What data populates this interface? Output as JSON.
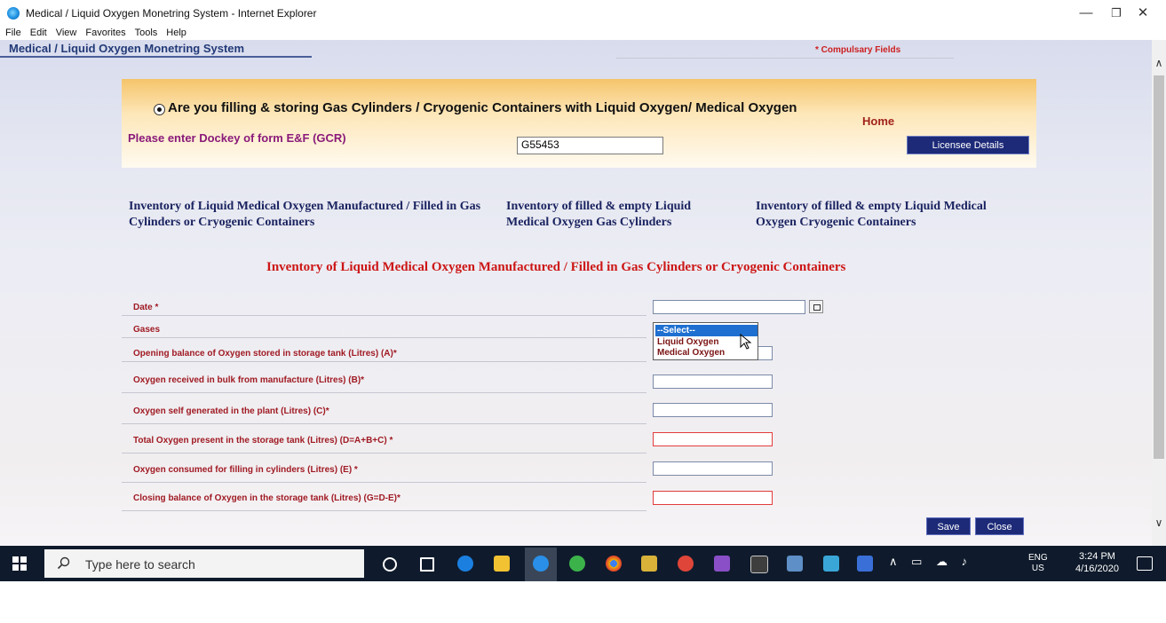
{
  "window": {
    "title": "Medical / Liquid Oxygen Monetring System - Internet Explorer",
    "controls": [
      "—",
      "❐",
      "✕"
    ]
  },
  "menubar": [
    "File",
    "Edit",
    "View",
    "Favorites",
    "Tools",
    "Help"
  ],
  "app": {
    "title": "Medical / Liquid Oxygen Monetring System",
    "required_note": "* Compulsary Fields"
  },
  "banner": {
    "question": "Are you filling & storing Gas Cylinders / Cryogenic Containers with Liquid Oxygen/ Medical Oxygen",
    "home": "Home",
    "dockey_label": "Please enter Dockey of form E&F (GCR)",
    "dockey_value": "G55453",
    "licensee_button": "Licensee Details"
  },
  "inventory_links": [
    "Inventory of Liquid Medical Oxygen Manufactured / Filled in Gas Cylinders or Cryogenic Containers",
    "Inventory of filled & empty Liquid Medical Oxygen Gas Cylinders",
    "Inventory of filled & empty Liquid Medical Oxygen Cryogenic Containers"
  ],
  "section_title": "Inventory of Liquid Medical Oxygen Manufactured / Filled in Gas Cylinders or Cryogenic Containers",
  "form": {
    "date_label": "Date *",
    "gases_label": "Gases",
    "gases_options": [
      "--Select--",
      "Liquid Oxygen",
      "Medical Oxygen"
    ],
    "opening_label": "Opening balance of Oxygen stored in storage tank (Litres) (A)*",
    "received_label": "Oxygen received in bulk from manufacture (Litres) (B)*",
    "self_generated_label": "Oxygen self generated in the plant (Litres) (C)*",
    "total_label": "Total Oxygen present in the storage tank (Litres) (D=A+B+C) *",
    "consumed_label": "Oxygen consumed for filling in cylinders (Litres) (E) *",
    "closing_label": "Closing balance of Oxygen in the storage tank (Litres) (G=D-E)*"
  },
  "buttons": {
    "save": "Save",
    "close": "Close"
  },
  "taskbar": {
    "search_placeholder": "Type here to search",
    "lang_top": "ENG",
    "lang_bottom": "US",
    "time": "3:24 PM",
    "date": "4/16/2020"
  }
}
